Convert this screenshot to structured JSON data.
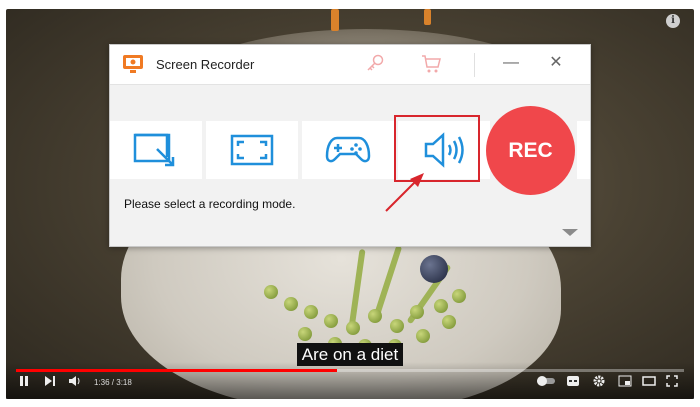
{
  "window": {
    "title": "Screen Recorder",
    "icons": {
      "app": "screen-recorder-app-icon",
      "key": "key-icon",
      "cart": "cart-icon"
    },
    "minimize_label": "—",
    "close_label": "✕"
  },
  "modes": [
    {
      "name": "region-mode",
      "icon": "region-select-icon"
    },
    {
      "name": "fullscreen-mode",
      "icon": "fullscreen-icon"
    },
    {
      "name": "game-mode",
      "icon": "gamepad-icon"
    },
    {
      "name": "audio-mode",
      "icon": "speaker-icon",
      "highlighted": true
    }
  ],
  "rec_button": "REC",
  "message": "Please select a recording mode.",
  "video": {
    "subtitle": "Are on a diet",
    "time": "1:36 / 3:18",
    "progress_fraction": 0.48,
    "info_label": "i"
  },
  "colors": {
    "accent": "#1f8fdb",
    "rec": "#f0474b",
    "highlight": "#d8262d",
    "progress": "#ff0000"
  }
}
